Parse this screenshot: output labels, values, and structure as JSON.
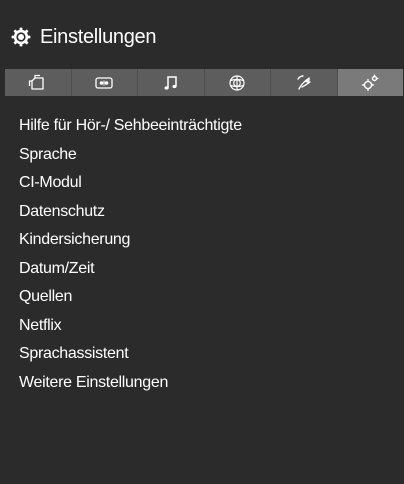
{
  "header": {
    "title": "Einstellungen",
    "icon": "gear-icon"
  },
  "tabs": [
    {
      "icon": "channels-icon",
      "active": false
    },
    {
      "icon": "picture-icon",
      "active": false
    },
    {
      "icon": "music-note-icon",
      "active": false
    },
    {
      "icon": "network-globe-icon",
      "active": false
    },
    {
      "icon": "satellite-dish-icon",
      "active": false
    },
    {
      "icon": "settings-gears-icon",
      "active": true
    }
  ],
  "menu": {
    "items": [
      {
        "label": "Hilfe für Hör-/ Sehbeeinträchtigte"
      },
      {
        "label": "Sprache"
      },
      {
        "label": "CI-Modul"
      },
      {
        "label": "Datenschutz"
      },
      {
        "label": "Kindersicherung"
      },
      {
        "label": "Datum/Zeit"
      },
      {
        "label": "Quellen"
      },
      {
        "label": "Netflix"
      },
      {
        "label": "Sprachassistent"
      },
      {
        "label": "Weitere Einstellungen"
      }
    ]
  },
  "colors": {
    "background": "#2b2b2b",
    "tabbar": "#5d5d5d",
    "active_tab": "#7a7a7a",
    "text": "#ffffff"
  }
}
